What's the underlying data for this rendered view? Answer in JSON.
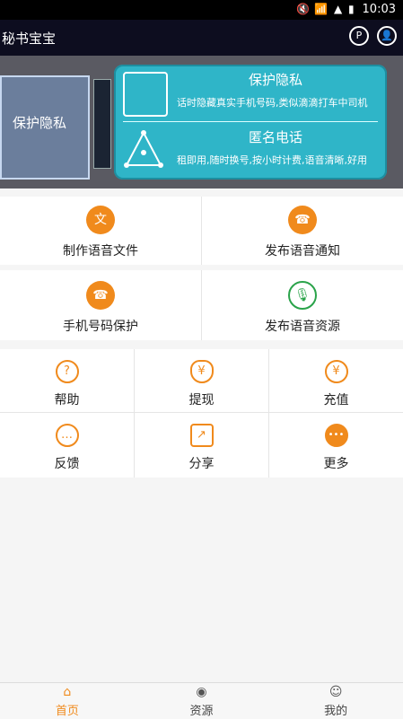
{
  "status_bar": {
    "time": "10:03"
  },
  "app_bar": {
    "title": "秘书宝宝"
  },
  "banner": {
    "cube_text": "保护隐私",
    "items": [
      {
        "title": "保护隐私",
        "subtitle": "话时隐藏真实手机号码,类似滴滴打车中司机"
      },
      {
        "title": "匿名电话",
        "subtitle": "租即用,随时换号,按小时计费,语音清晰,好用"
      }
    ]
  },
  "grid_main": [
    [
      {
        "label": "制作语音文件",
        "icon": "文",
        "icon_name": "voice-file-icon"
      },
      {
        "label": "发布语音通知",
        "icon": "☎",
        "icon_name": "voice-notice-icon"
      }
    ],
    [
      {
        "label": "手机号码保护",
        "icon": "☎",
        "icon_name": "phone-protect-icon"
      },
      {
        "label": "发布语音资源",
        "icon": "🎙",
        "icon_name": "mic-icon"
      }
    ]
  ],
  "grid_small": [
    [
      {
        "label": "帮助",
        "icon": "?",
        "icon_name": "help-icon"
      },
      {
        "label": "提现",
        "icon": "¥",
        "icon_name": "withdraw-icon"
      },
      {
        "label": "充值",
        "icon": "¥",
        "icon_name": "recharge-icon"
      }
    ],
    [
      {
        "label": "反馈",
        "icon": "…",
        "icon_name": "feedback-icon"
      },
      {
        "label": "分享",
        "icon": "↗",
        "icon_name": "share-icon"
      },
      {
        "label": "更多",
        "icon": "•••",
        "icon_name": "more-icon"
      }
    ]
  ],
  "tabs": [
    {
      "label": "首页",
      "icon": "⌂",
      "icon_name": "home-icon",
      "active": true
    },
    {
      "label": "资源",
      "icon": "◉",
      "icon_name": "resource-icon",
      "active": false
    },
    {
      "label": "我的",
      "icon": "☺",
      "icon_name": "profile-icon",
      "active": false
    }
  ],
  "colors": {
    "accent": "#f08a1c",
    "appbar": "#0d0d1f",
    "banner_card": "#2fb5c8",
    "mic_green": "#2aa34a"
  }
}
